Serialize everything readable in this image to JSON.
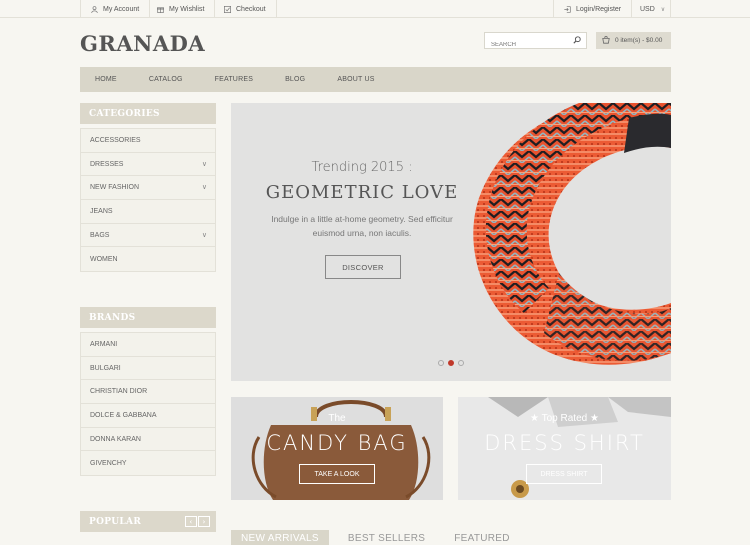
{
  "topbar": {
    "my_account": "My Account",
    "my_wishlist": "My Wishlist",
    "checkout": "Checkout",
    "login_register": "Login/Register",
    "currency": "USD"
  },
  "header": {
    "logo": "GRANADA",
    "search_placeholder": "SEARCH",
    "cart": "0 item(s) - $0.00"
  },
  "nav": {
    "items": [
      "HOME",
      "CATALOG",
      "FEATURES",
      "BLOG",
      "ABOUT US"
    ]
  },
  "categories": {
    "title": "CATEGORIES",
    "items": [
      "ACCESSORIES",
      "DRESSES",
      "NEW FASHION",
      "JEANS",
      "BAGS",
      "WOMEN"
    ]
  },
  "brands": {
    "title": "BRANDS",
    "items": [
      "ARMANI",
      "BULGARI",
      "CHRISTIAN DIOR",
      "DOLCE & GABBANA",
      "DONNA KARAN",
      "GIVENCHY"
    ]
  },
  "popular": {
    "title": "POPULAR"
  },
  "hero": {
    "kicker": "Trending 2015 :",
    "title": "GEOMETRIC LOVE",
    "desc": "Indulge in a little at-home geometry. Sed efficitur euismod urna, non iaculis.",
    "button": "DISCOVER",
    "slide_count": 3,
    "active_slide": 2
  },
  "promo1": {
    "small": "The",
    "big": "CANDY BAG",
    "button": "TAKE A LOOK"
  },
  "promo2": {
    "small": "★ Top Rated ★",
    "big": "DRESS SHIRT",
    "button": "DRESS SHIRT"
  },
  "tabs": [
    "NEW ARRIVALS",
    "BEST SELLERS",
    "FEATURED"
  ],
  "colors": {
    "accent": "#c0392b",
    "nav_bg": "#d9d6c9",
    "page_bg": "#f7f6f1"
  }
}
